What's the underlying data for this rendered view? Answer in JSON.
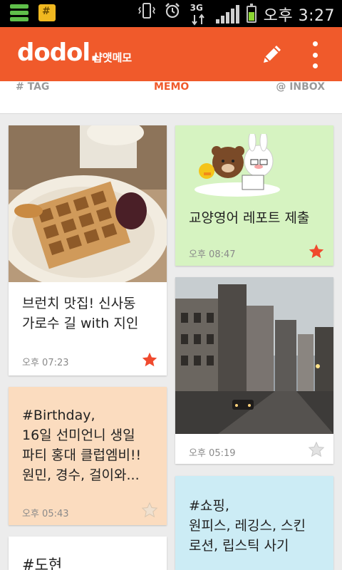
{
  "statusbar": {
    "network": "3G",
    "time": "오후 3:27",
    "battery_level": 0.6
  },
  "header": {
    "logo": "dodol.",
    "subtitle": "샵앳메모",
    "compose_icon": "pencil-icon",
    "menu_icon": "more-vert-icon",
    "color": "#f05a2b"
  },
  "tabs": [
    {
      "label": "# TAG"
    },
    {
      "label": "MEMO"
    },
    {
      "label": "@ INBOX"
    }
  ],
  "active_tab": "MEMO",
  "memos": [
    {
      "text": "브런치 맛집! 신사동\n가로수 길 with 지인",
      "date": "오후 07:23",
      "starred": true,
      "image": "waffle-photo"
    },
    {
      "text": "교양영어 레포트 제출",
      "date": "오후 08:47",
      "starred": true,
      "image": "sticker-illustration",
      "color": "#d6f3c1"
    },
    {
      "text": "",
      "date": "오후 05:19",
      "starred": false,
      "image": "city-street-photo"
    },
    {
      "text": "#Birthday,\n16일 선미언니 생일\n파티 홍대 클럽엠비!!\n원민, 경수, 걸이와...",
      "date": "오후 05:43",
      "starred": false,
      "color": "#fbdcbf"
    },
    {
      "text": "#쇼핑,\n원피스, 레깅스, 스킨\n로션, 립스틱 사기",
      "date": "",
      "starred": false,
      "color": "#ccecf5"
    },
    {
      "text": "#도현",
      "date": "",
      "starred": false
    }
  ],
  "colors": {
    "accent": "#f05a2b",
    "star_on": "#f04a2e",
    "star_off": "#d8d8d8"
  }
}
